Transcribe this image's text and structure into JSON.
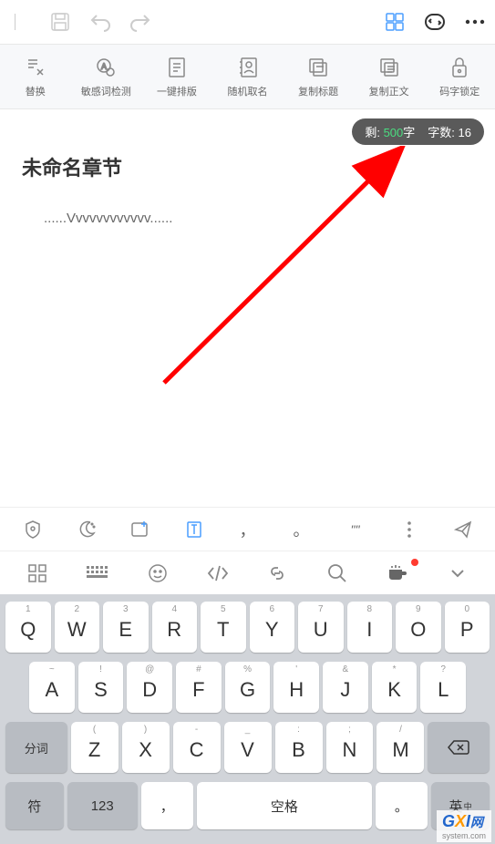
{
  "toolbar": {
    "items": [
      {
        "label": "替换"
      },
      {
        "label": "敏感词检测"
      },
      {
        "label": "一键排版"
      },
      {
        "label": "随机取名"
      },
      {
        "label": "复制标题"
      },
      {
        "label": "复制正文"
      },
      {
        "label": "码字锁定"
      }
    ]
  },
  "counter": {
    "remain_label": "剩:",
    "remain_value": "500",
    "remain_unit": "字",
    "count_label": "字数:",
    "count_value": "16"
  },
  "content": {
    "title": "未命名章节",
    "body": "......Vvvvvvvvvvvv......"
  },
  "kbTools1": {
    "comma": "，",
    "period": "。",
    "quote": "\"\""
  },
  "keyboard": {
    "row1_sup": [
      "1",
      "2",
      "3",
      "4",
      "5",
      "6",
      "7",
      "8",
      "9",
      "0"
    ],
    "row1": [
      "Q",
      "W",
      "E",
      "R",
      "T",
      "Y",
      "U",
      "I",
      "O",
      "P"
    ],
    "row2_sup": [
      "~",
      "!",
      "@",
      "#",
      "%",
      "'",
      "&",
      "*",
      "?"
    ],
    "row2": [
      "A",
      "S",
      "D",
      "F",
      "G",
      "H",
      "J",
      "K",
      "L"
    ],
    "row3_sup": [
      "(",
      ")",
      "-",
      "_",
      ":",
      ";",
      "/"
    ],
    "row3": [
      "Z",
      "X",
      "C",
      "V",
      "B",
      "N",
      "M"
    ],
    "shift": "分词",
    "bottom": {
      "sym": "符",
      "num": "123",
      "comma": "，",
      "space": "空格",
      "period": "。",
      "lang": "英"
    }
  },
  "watermark": {
    "g": "G",
    "x": "X",
    "i": "I",
    "suffix": "网",
    "sub": "system.com"
  }
}
